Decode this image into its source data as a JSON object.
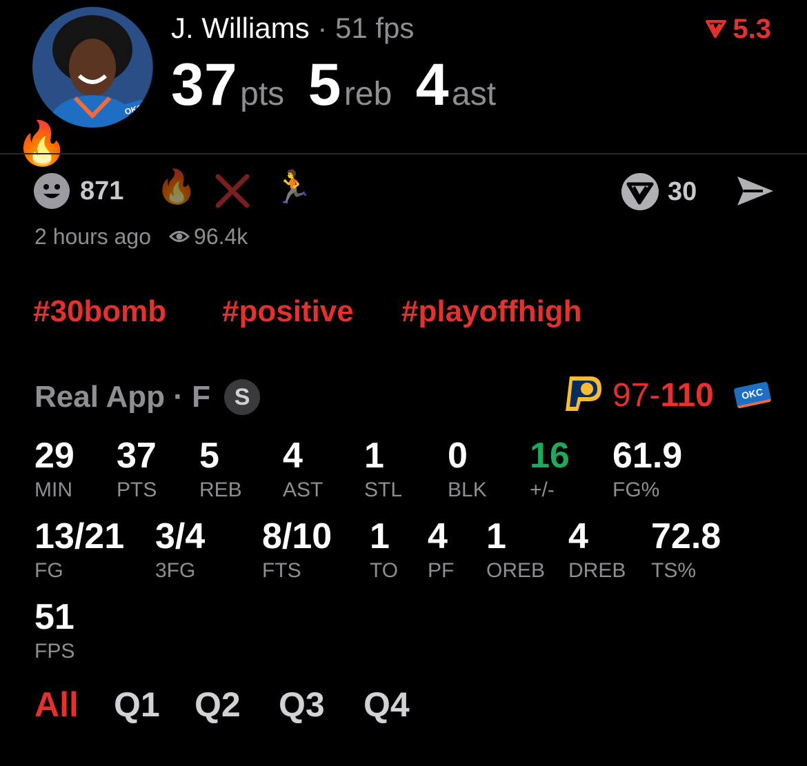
{
  "player": {
    "name": "J. Williams",
    "separator": "·",
    "fps_label": "51 fps",
    "team_badge": "OKC",
    "rating": "5.3",
    "points": "37",
    "points_unit": "pts",
    "rebounds": "5",
    "rebounds_unit": "reb",
    "assists": "4",
    "assists_unit": "ast"
  },
  "actions": {
    "reactions": "871",
    "shares": "30",
    "time_ago": "2 hours ago",
    "views": "96.4k"
  },
  "hashtags": [
    "#30bomb",
    "#positive",
    "#playoffhigh"
  ],
  "game": {
    "source": "Real App · F",
    "badge": "S",
    "score_left": "97-",
    "score_right": "110",
    "away_team": "OKC"
  },
  "stats_row1": [
    {
      "value": "29",
      "label": "MIN"
    },
    {
      "value": "37",
      "label": "PTS"
    },
    {
      "value": "5",
      "label": "REB"
    },
    {
      "value": "4",
      "label": "AST"
    },
    {
      "value": "1",
      "label": "STL"
    },
    {
      "value": "0",
      "label": "BLK"
    },
    {
      "value": "16",
      "label": "+/-"
    },
    {
      "value": "61.9",
      "label": "FG%"
    }
  ],
  "stats_row2": [
    {
      "value": "13/21",
      "label": "FG"
    },
    {
      "value": "3/4",
      "label": "3FG"
    },
    {
      "value": "8/10",
      "label": "FTS"
    },
    {
      "value": "1",
      "label": "TO"
    },
    {
      "value": "4",
      "label": "PF"
    },
    {
      "value": "1",
      "label": "OREB"
    },
    {
      "value": "4",
      "label": "DREB"
    },
    {
      "value": "72.8",
      "label": "TS%"
    }
  ],
  "stats_row3": [
    {
      "value": "51",
      "label": "FPS"
    }
  ],
  "tabs": [
    "All",
    "Q1",
    "Q2",
    "Q3",
    "Q4"
  ],
  "colors": {
    "accent": "#e5312e",
    "positive": "#1faa5b",
    "muted": "#8e8e93",
    "background": "#000000"
  },
  "icons": [
    "fire-emoji",
    "smiley-icon",
    "fire-emoji",
    "x-mark-icon",
    "runner-emoji",
    "eye-icon",
    "real-logo-icon",
    "send-icon",
    "pacers-logo",
    "thunder-logo"
  ]
}
